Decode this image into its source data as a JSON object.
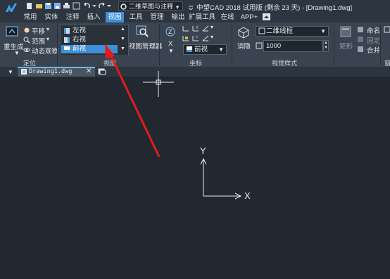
{
  "title_bar": {
    "workspace": "二维草图与注释",
    "title": "中望CAD 2018 试用版 (剩余 23 天) - [Drawing1.dwg]"
  },
  "ribbon_tabs": [
    {
      "label": "常用"
    },
    {
      "label": "实体"
    },
    {
      "label": "注释"
    },
    {
      "label": "插入"
    },
    {
      "label": "视图",
      "active": true
    },
    {
      "label": "工具"
    },
    {
      "label": "管理"
    },
    {
      "label": "输出"
    },
    {
      "label": "扩展工具"
    },
    {
      "label": "在线"
    },
    {
      "label": "APP+"
    }
  ],
  "panels": {
    "locate": {
      "label": "定位",
      "regen": "重生成",
      "pan": "平移",
      "range": "范围",
      "dynamic_view": "动态观察"
    },
    "views": {
      "label": "视图",
      "items": [
        {
          "label": "左视",
          "selected": false
        },
        {
          "label": "右视",
          "selected": false
        },
        {
          "label": "前视",
          "selected": true
        }
      ],
      "manager": "视图管理器"
    },
    "coords": {
      "label": "坐标",
      "ucs_axis": "X",
      "ucs_view": "前视"
    },
    "visual_style": {
      "label": "视觉样式",
      "style_label": "消隐",
      "style_value": "二维线框",
      "size_value": "1000"
    },
    "window": {
      "label": "窗",
      "rename": "命名",
      "dock": "固定",
      "merge": "合并",
      "rect": "矩形"
    }
  },
  "document_tab": {
    "name": "Drawing1.dwg"
  },
  "canvas": {
    "ucs_x": "X",
    "ucs_y": "Y"
  },
  "colors": {
    "accent": "#3b8ed6",
    "annotation_arrow": "#e21b1b",
    "canvas_bg": "#212830"
  }
}
